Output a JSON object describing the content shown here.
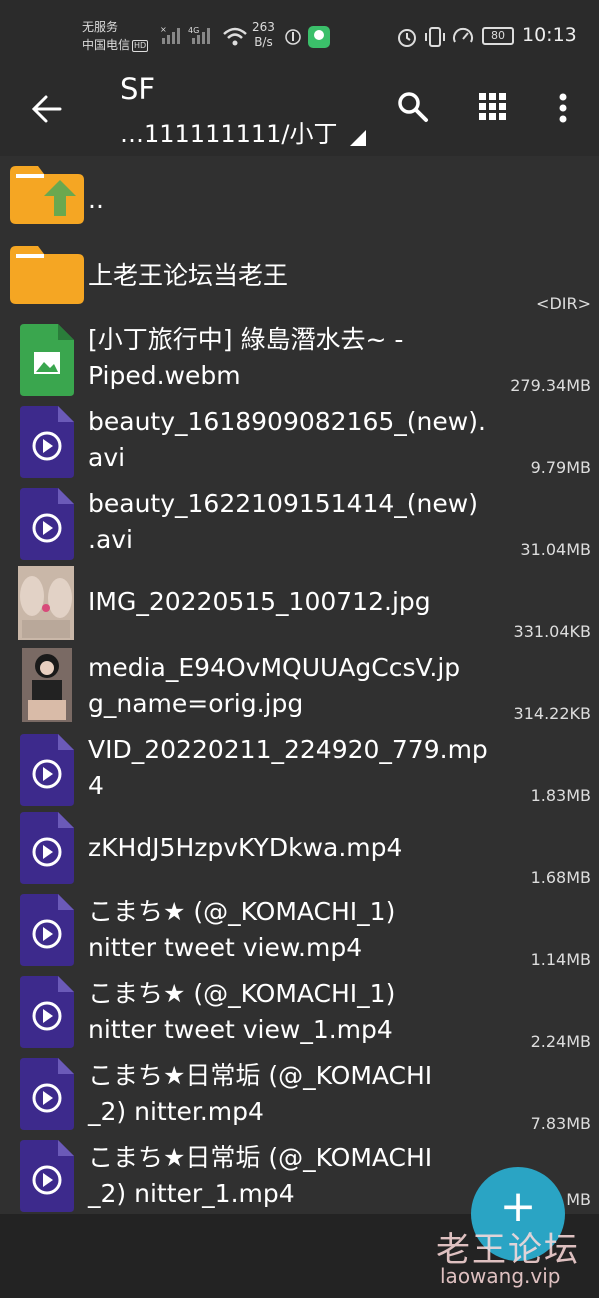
{
  "statusbar": {
    "carrier_line1": "无服务",
    "carrier_line2": "中国电信",
    "hd": "HD",
    "net_4g": "4G",
    "speed_value": "263",
    "speed_unit": "B/s",
    "battery": "80",
    "time": "10:13"
  },
  "toolbar": {
    "title": "SF",
    "path": "…111111111/小丁",
    "back_icon": "arrow-left-icon",
    "search_icon": "search-icon",
    "grid_icon": "grid-icon",
    "menu_icon": "more-vert-icon"
  },
  "files": [
    {
      "name": "..",
      "size": "",
      "kind": "folder-up"
    },
    {
      "name": "上老王论坛当老王",
      "size": "<DIR>",
      "kind": "folder"
    },
    {
      "name": "[小丁旅行中] 綠島潛水去~ -\nPiped.webm",
      "size": "279.34MB",
      "kind": "image-file"
    },
    {
      "name": "beauty_1618909082165_(new).\navi",
      "size": "9.79MB",
      "kind": "video"
    },
    {
      "name": "beauty_1622109151414_(new)\n.avi",
      "size": "31.04MB",
      "kind": "video"
    },
    {
      "name": "IMG_20220515_100712.jpg",
      "size": "331.04KB",
      "kind": "thumb-1"
    },
    {
      "name": "media_E94OvMQUUAgCcsV.jp\ng_name=orig.jpg",
      "size": "314.22KB",
      "kind": "thumb-2"
    },
    {
      "name": "VID_20220211_224920_779.mp\n4",
      "size": "1.83MB",
      "kind": "video"
    },
    {
      "name": "zKHdJ5HzpvKYDkwa.mp4",
      "size": "1.68MB",
      "kind": "video"
    },
    {
      "name": "こまち★ (@_KOMACHI_1)\nnitter tweet view.mp4",
      "size": "1.14MB",
      "kind": "video"
    },
    {
      "name": "こまち★ (@_KOMACHI_1)\nnitter tweet view_1.mp4",
      "size": "2.24MB",
      "kind": "video"
    },
    {
      "name": "こまち★日常垢 (@_KOMACHI\n_2) nitter.mp4",
      "size": "7.83MB",
      "kind": "video"
    },
    {
      "name": "こまち★日常垢 (@_KOMACHI\n_2) nitter_1.mp4",
      "size": "MB",
      "kind": "video"
    }
  ],
  "fab_label": "+",
  "watermark": {
    "title": "老王论坛",
    "url": "laowang.vip"
  },
  "colors": {
    "background": "#303030",
    "bar": "#2b2b2b",
    "folder": "#f5a623",
    "video_icon": "#3d2a8c",
    "image_icon": "#3aa64e",
    "fab": "#2aa4c4"
  }
}
